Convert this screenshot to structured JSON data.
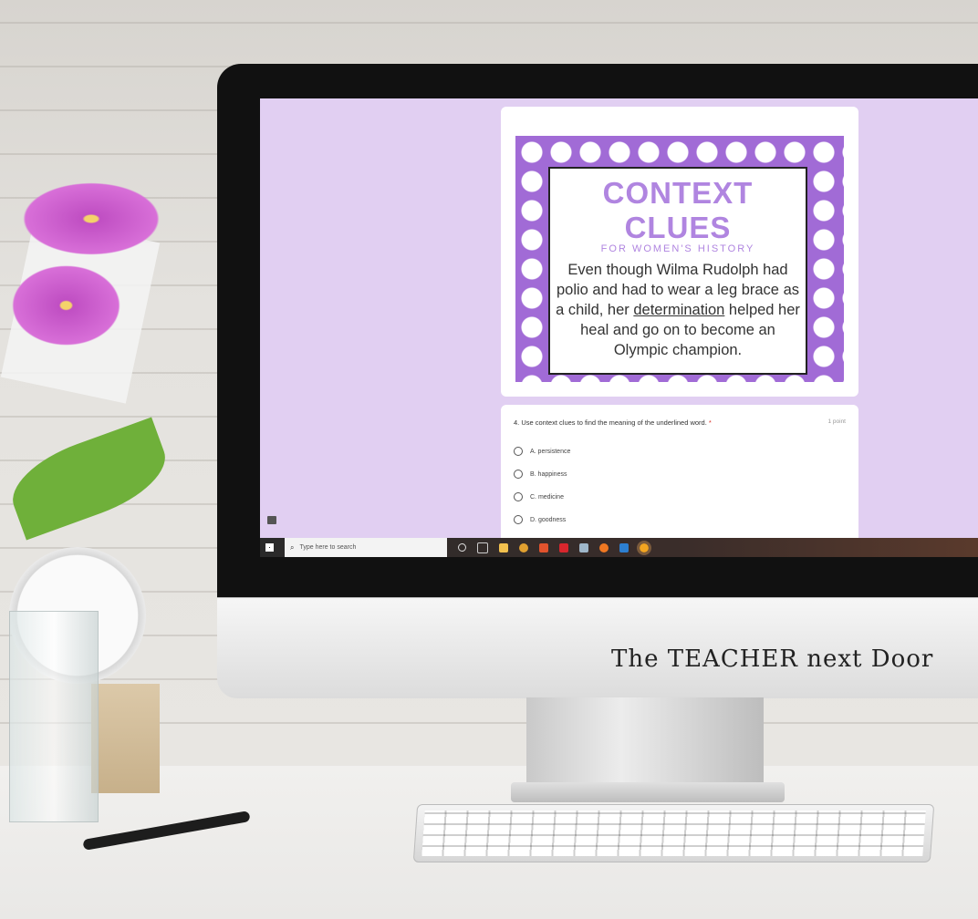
{
  "card": {
    "title": "CONTEXT CLUES",
    "subtitle": "FOR WOMEN'S HISTORY",
    "text_before": "Even though Wilma Rudolph had polio and had to wear a leg brace as a child, her ",
    "underlined_word": "determination",
    "text_after": " helped her heal and go on to become an Olympic champion."
  },
  "question": {
    "text": "4. Use context clues to find the meaning of the underlined word.",
    "required_mark": "*",
    "points": "1 point",
    "options": [
      "A. persistence",
      "B. happiness",
      "C. medicine",
      "D. goodness"
    ]
  },
  "taskbar": {
    "search_placeholder": "Type here to search"
  },
  "brand": "The TEACHER next Door",
  "colors": {
    "screen_bg": "#e1cff2",
    "accent_purple": "#a16bd6",
    "title_purple": "#b085e0",
    "required_red": "#d93025"
  },
  "icons": [
    "windows-start-icon",
    "search-icon",
    "cortana-icon",
    "task-view-icon",
    "feedback-icon"
  ]
}
